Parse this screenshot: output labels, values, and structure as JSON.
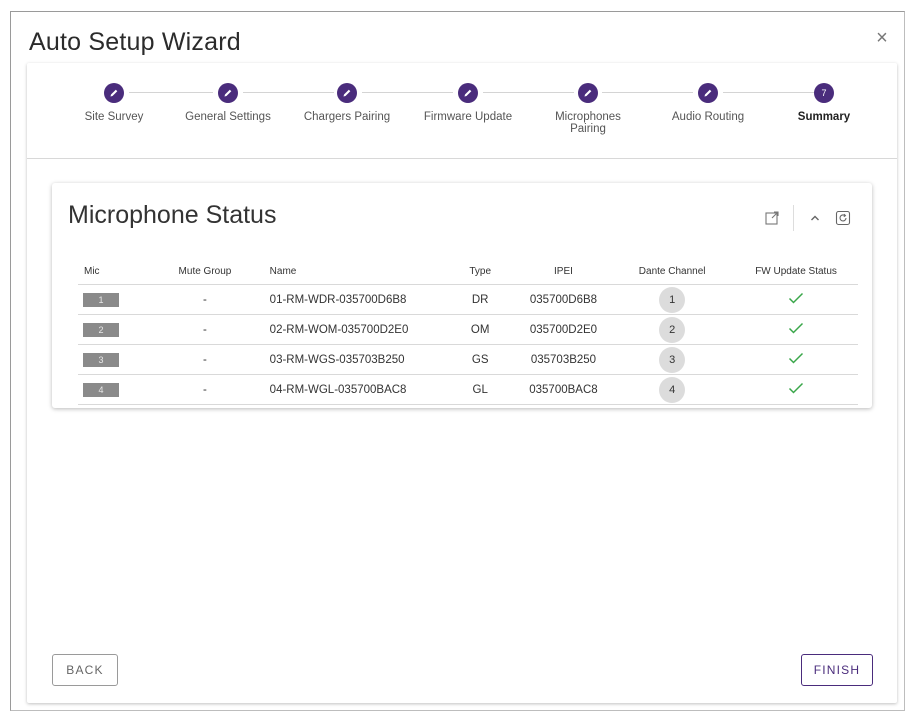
{
  "dialog": {
    "title": "Auto Setup Wizard",
    "close_label": "×"
  },
  "stepper": {
    "steps": [
      {
        "label": "Site Survey",
        "state": "completed"
      },
      {
        "label": "General Settings",
        "state": "completed"
      },
      {
        "label": "Chargers Pairing",
        "state": "completed"
      },
      {
        "label": "Firmware Update",
        "state": "completed"
      },
      {
        "label": "Microphones\nPairing",
        "state": "completed"
      },
      {
        "label": "Audio Routing",
        "state": "completed"
      },
      {
        "label": "Summary",
        "state": "active",
        "number": "7"
      }
    ],
    "accent_color": "#4a2c7c"
  },
  "mic_status": {
    "title": "Microphone Status",
    "columns": [
      "Mic",
      "Mute Group",
      "Name",
      "Type",
      "IPEI",
      "Dante Channel",
      "FW Update Status"
    ],
    "rows": [
      {
        "mic": "1",
        "mute_group": "-",
        "name": "01-RM-WDR-035700D6B8",
        "type": "DR",
        "ipei": "035700D6B8",
        "dante_channel": "1",
        "fw_status": "check-icon"
      },
      {
        "mic": "2",
        "mute_group": "-",
        "name": "02-RM-WOM-035700D2E0",
        "type": "OM",
        "ipei": "035700D2E0",
        "dante_channel": "2",
        "fw_status": "check-icon"
      },
      {
        "mic": "3",
        "mute_group": "-",
        "name": "03-RM-WGS-035703B250",
        "type": "GS",
        "ipei": "035703B250",
        "dante_channel": "3",
        "fw_status": "check-icon"
      },
      {
        "mic": "4",
        "mute_group": "-",
        "name": "04-RM-WGL-035700BAC8",
        "type": "GL",
        "ipei": "035700BAC8",
        "dante_channel": "4",
        "fw_status": "check-icon"
      }
    ],
    "tools": [
      "open-external-icon",
      "chevron-up-icon",
      "refresh-icon"
    ],
    "check_color": "#3aa64a"
  },
  "footer": {
    "back_label": "BACK",
    "finish_label": "FINISH"
  }
}
